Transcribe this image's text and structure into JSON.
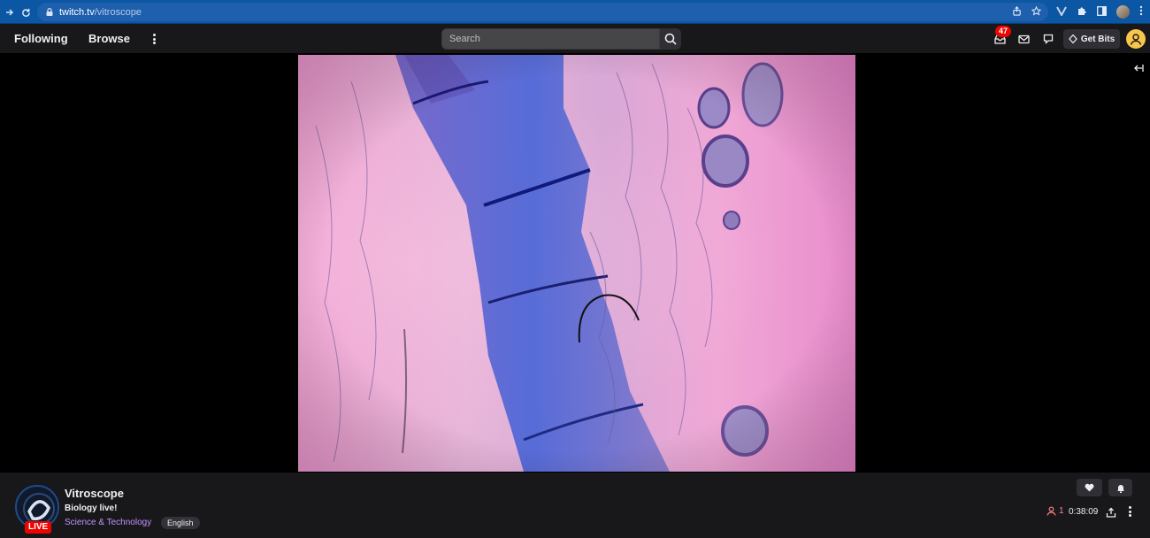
{
  "browser": {
    "url_host": "twitch.tv",
    "url_path": "/vitroscope"
  },
  "topnav": {
    "following": "Following",
    "browse": "Browse",
    "search_placeholder": "Search",
    "notification_count": "47",
    "get_bits": "Get Bits"
  },
  "channel": {
    "name": "Vitroscope",
    "title": "Biology live!",
    "category": "Science & Technology",
    "tag": "English",
    "live_label": "LIVE",
    "viewers": "1",
    "uptime": "0:38:09"
  },
  "colors": {
    "accent": "#9147ff",
    "category_link": "#bf94ff",
    "live": "#eb0400",
    "viewer_count": "#ff8280"
  }
}
